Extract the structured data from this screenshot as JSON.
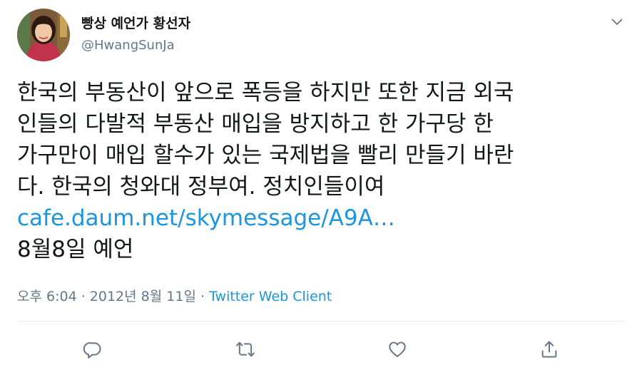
{
  "tweet": {
    "display_name": "빵상 예언가 황선자",
    "handle": "@HwangSunJa",
    "lines": [
      "한국의 부동산이 앞으로 폭등을 하지만 또한 지금 외국",
      "인들의 다발적 부동산 매입을 방지하고 한 가구당 한",
      "가구만이 매입 할수가 있는 국제법을 빨리 만들기 바란",
      "다. 한국의 청와대 정부여. 정치인들이여"
    ],
    "link": "cafe.daum.net/skymessage/A9A…",
    "trailing": "8월8일 예언",
    "time": "오후 6:04",
    "separator": " · ",
    "date": "2012년 8월 11일",
    "source": "Twitter Web Client"
  },
  "icons": {
    "caret": "chevron-down-icon",
    "reply": "reply-icon",
    "retweet": "retweet-icon",
    "like": "heart-icon",
    "share": "share-icon"
  },
  "colors": {
    "text": "#14171a",
    "secondary": "#657786",
    "link": "#1b95e0",
    "divider": "#e6ecf0"
  }
}
